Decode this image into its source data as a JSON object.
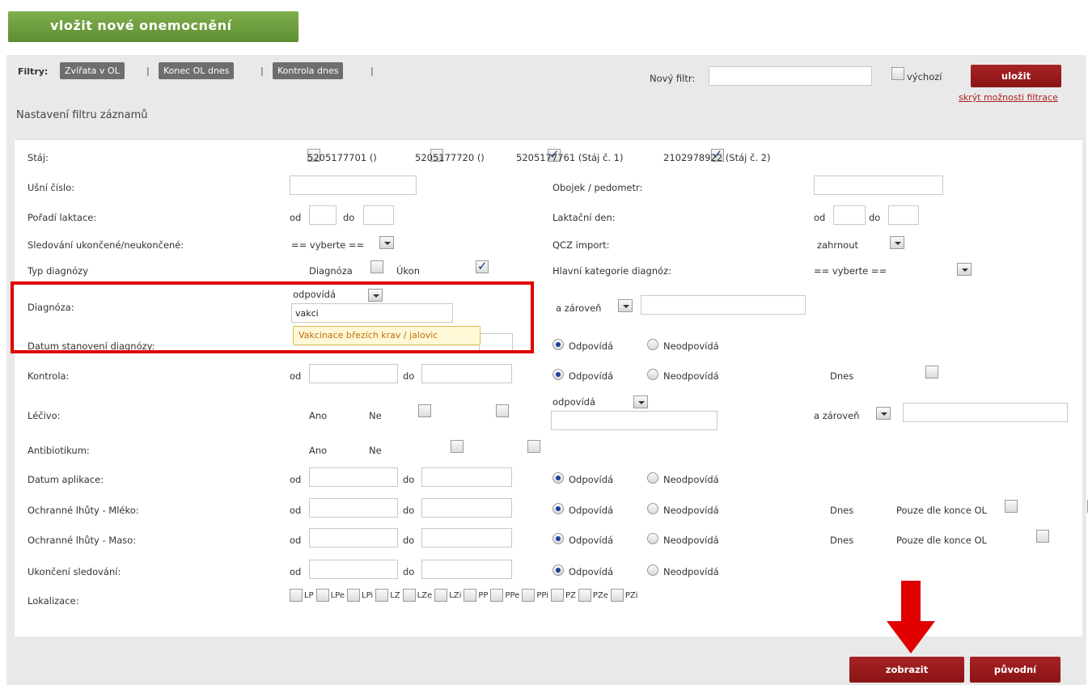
{
  "header": {
    "new_disease_button": "vložit nové onemocnění"
  },
  "filter_bar": {
    "label": "Filtry:",
    "chips": [
      "Zvířata v OL",
      "Konec OL dnes",
      "Kontrola dnes"
    ],
    "separator": "|",
    "new_filter_label": "Nový filtr:",
    "default_label": "výchozí",
    "save_button": "uložit",
    "hide_options_link": "skrýt možnosti filtrace"
  },
  "section_title": "Nastavení filtru záznamů",
  "common": {
    "od": "od",
    "do": "do",
    "matches": "Odpovídá",
    "not_matches": "Neodpovídá",
    "today": "Dnes",
    "only_by_ol_end": "Pouze dle konce OL",
    "yes": "Ano",
    "no": "Ne",
    "and_also": "a zároveň",
    "select_placeholder": "== vyberte ==",
    "odpovida": "odpovídá"
  },
  "form": {
    "stable": {
      "label": "Stáj:",
      "options": [
        {
          "text": "5205177701 ()",
          "checked": false
        },
        {
          "text": "5205177720 ()",
          "checked": false
        },
        {
          "text": "5205177761 (Stáj č. 1)",
          "checked": true
        },
        {
          "text": "2102978922 (Stáj č. 2)",
          "checked": true
        }
      ]
    },
    "ear_number": "Ušní číslo:",
    "collar": "Obojek / pedometr:",
    "lactation_order": "Pořadí laktace:",
    "lactation_day": "Laktační den:",
    "tracking": "Sledování ukončené/neukončené:",
    "qcz_import": "QCZ import:",
    "qcz_value": "zahrnout",
    "diagnosis_type": "Typ diagnózy",
    "diagnosis_type_opt1": "Diagnóza",
    "diagnosis_type_opt2": "Úkon",
    "main_category": "Hlavní kategorie diagnóz:",
    "diagnosis": "Diagnóza:",
    "diagnosis_input_value": "vakci",
    "diagnosis_suggestion": "Vakcinace březích krav / jalovic",
    "diagnosis_date": "Datum stanovení diagnózy:",
    "control": "Kontrola:",
    "drug": "Léčivo:",
    "antibiotic": "Antibiotikum:",
    "application_date": "Datum aplikace:",
    "protect_milk": "Ochranné lhůty - Mléko:",
    "protect_meat": "Ochranné lhůty - Maso:",
    "tracking_end": "Ukončení sledování:",
    "localization": "Lokalizace:",
    "localization_options": [
      "LP",
      "LPe",
      "LPi",
      "LZ",
      "LZe",
      "LZi",
      "PP",
      "PPe",
      "PPi",
      "PZ",
      "PZe",
      "PZi"
    ]
  },
  "actions": {
    "show_button": "zobrazit",
    "reset_button": "původní"
  },
  "colors": {
    "green": "#6e9e3e",
    "red": "#a11b1d",
    "panel": "#e9e9e9",
    "annotation": "#e00000"
  }
}
